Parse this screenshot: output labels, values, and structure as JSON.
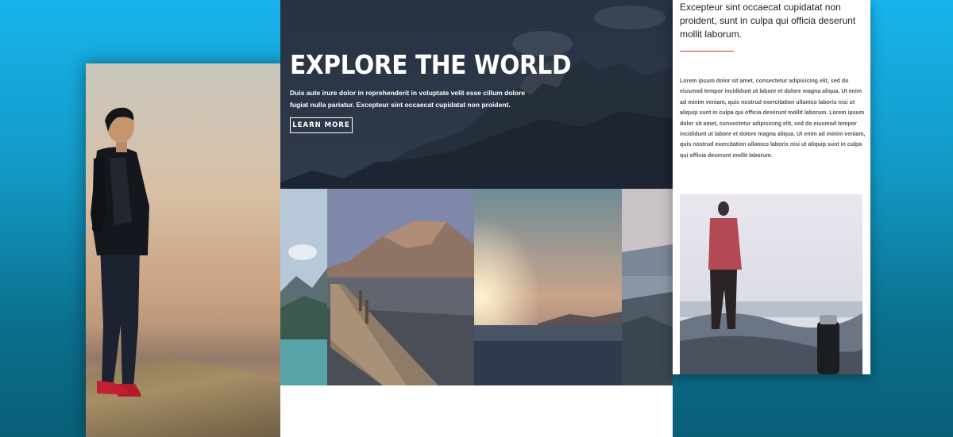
{
  "hero": {
    "title": "EXPLORE THE WORLD",
    "text": "Duis aute irure dolor in reprehenderit in voluptate velit esse cillum dolore fugiat nulla pariatur. Excepteur sint occaecat cupidatat non proident.",
    "button_label": "LEARN MORE"
  },
  "right_page": {
    "quote": "Excepteur sint occaecat cupidatat non proident, sunt in culpa qui officia deserunt mollit laborum.",
    "body": "Lorem ipsum dolor sit amet, consectetur adipisicing elit, sed do eiusmod tempor incididunt ut labore et dolore magna aliqua. Ut enim ad minim veniam, quis nostrud exercitation ullamco laboris nisi ut aliquip sunt in culpa qui officia deserunt mollit laborum. Lorem ipsum dolor sit amet, consectetur adipisicing elit, sed do eiusmod tempor incididunt ut labore et dolore magna aliqua. Ut enim ad minim veniam, quis nostrud exercitation ullamco laboris nisi ut aliquip sunt in culpa qui officia deserunt mollit laborum."
  },
  "colors": {
    "accent_divider": "#d9362b",
    "background_top": "#18b4ec",
    "background_bottom": "#0a5f78",
    "hero_overlay": "#263244"
  }
}
